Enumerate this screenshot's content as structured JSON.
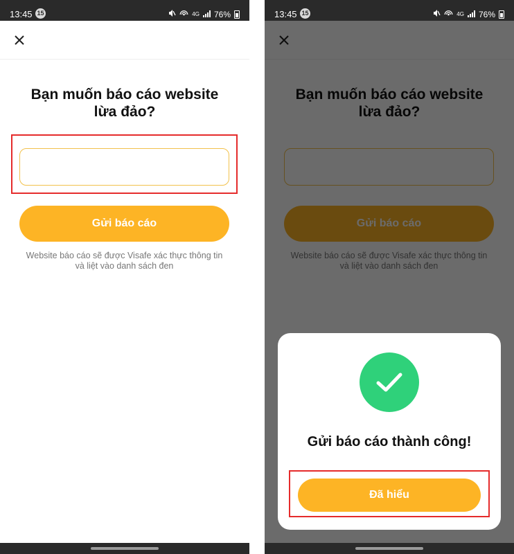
{
  "status_bar": {
    "time": "13:45",
    "badge": "15",
    "network": "4G",
    "battery": "76%"
  },
  "report_screen": {
    "title_line1": "Bạn muốn báo cáo website",
    "title_line2": "lừa đảo?",
    "url_input_value": "",
    "submit_label": "Gửi báo cáo",
    "info_line1": "Website báo cáo sẽ được Visafe xác thực thông tin",
    "info_line2": "và liệt vào danh sách đen"
  },
  "success_dialog": {
    "message": "Gửi báo cáo thành công!",
    "confirm_label": "Đã hiểu"
  },
  "colors": {
    "accent": "#fdb425",
    "success": "#2fd17a",
    "highlight": "#e52b2b"
  },
  "icons": [
    "close-icon",
    "mute-icon",
    "hotspot-icon",
    "signal-icon",
    "battery-icon",
    "check-icon"
  ]
}
